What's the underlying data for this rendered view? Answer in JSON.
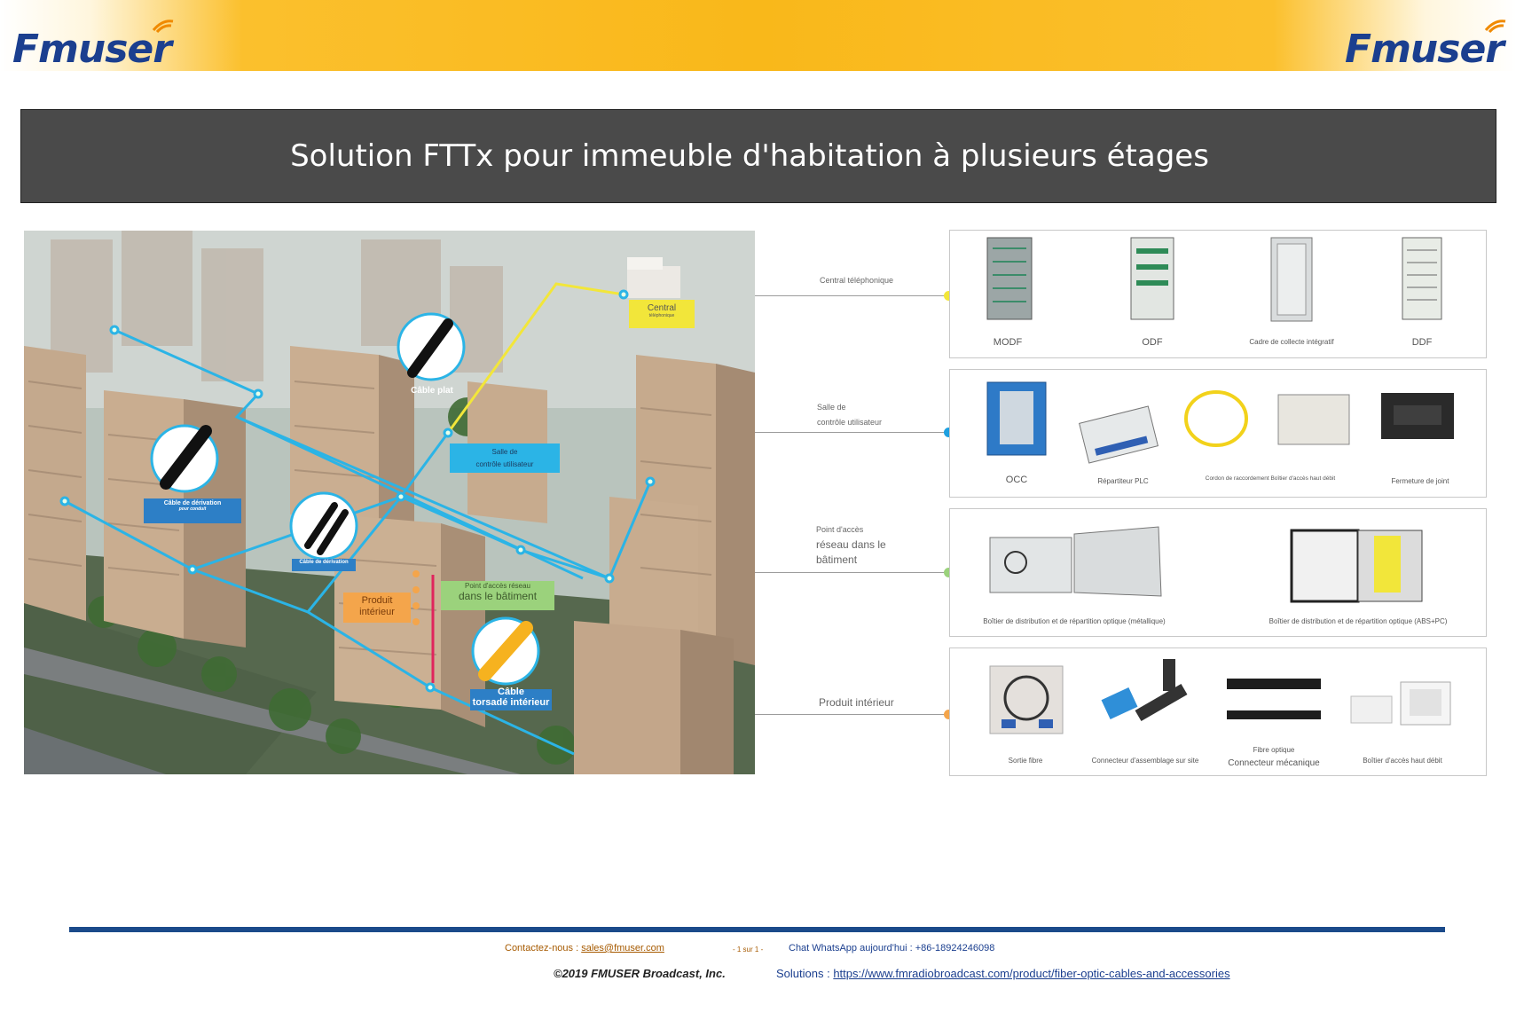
{
  "header": {
    "logo_left": "Fmuser",
    "logo_right": "Fmuser",
    "title": "Solution FTTx pour immeuble d'habitation à plusieurs étages"
  },
  "aerial": {
    "labels": {
      "central_1": "Central",
      "central_2": "téléphonique",
      "cable_plat": "Câble plat",
      "salle_1": "Salle de",
      "salle_2": "contrôle utilisateur",
      "derivation_conduit_1": "Câble de dérivation",
      "derivation_conduit_2": "pour conduit",
      "derivation": "Câble de dérivation",
      "point_acces_1": "Point d'accès réseau",
      "point_acces_2": "dans le bâtiment",
      "produit_1": "Produit",
      "produit_2": "intérieur",
      "torsade_1": "Câble",
      "torsade_2": "torsadé intérieur"
    }
  },
  "rows": [
    {
      "label_lines": [
        "Central téléphonique"
      ],
      "dot_color": "#f2e63a",
      "items": [
        "MODF",
        "ODF",
        "Cadre de collecte intégratif",
        "DDF"
      ]
    },
    {
      "label_lines": [
        "Salle de",
        "contrôle utilisateur"
      ],
      "dot_color": "#1ea0e0",
      "items": [
        "OCC",
        "Répartiteur PLC",
        "Cordon de raccordement Boîtier d'accès haut débit",
        "Fermeture de joint"
      ]
    },
    {
      "label_lines": [
        "Point d'accès",
        "réseau dans le",
        "bâtiment"
      ],
      "dot_color": "#9bd27c",
      "items": [
        "Boîtier de distribution et de répartition optique (métallique)",
        "Boîtier de distribution et de répartition optique (ABS+PC)"
      ]
    },
    {
      "label_lines": [
        "Produit intérieur"
      ],
      "dot_color": "#f4a54b",
      "items": [
        "Sortie fibre",
        "Connecteur d'assemblage sur site",
        "Fibre optique",
        "Connecteur mécanique",
        "Boîtier d'accès haut débit"
      ]
    }
  ],
  "footer": {
    "contact_label": "Contactez-nous : ",
    "contact_email": "sales@fmuser.com",
    "page": "- 1 sur 1 -",
    "whatsapp": "Chat WhatsApp aujourd'hui : +86-18924246098",
    "copyright": "©2019 FMUSER Broadcast, Inc.",
    "solutions_label": "Solutions : ",
    "solutions_url": "https://www.fmradiobroadcast.com/product/fiber-optic-cables-and-accessories"
  },
  "colors": {
    "brand_blue": "#1b3f8f",
    "header_orange": "#f9b81a",
    "title_bar": "#4a4a4a",
    "cable_blue": "#2bb4e6",
    "cable_yellow": "#f2e63a"
  }
}
